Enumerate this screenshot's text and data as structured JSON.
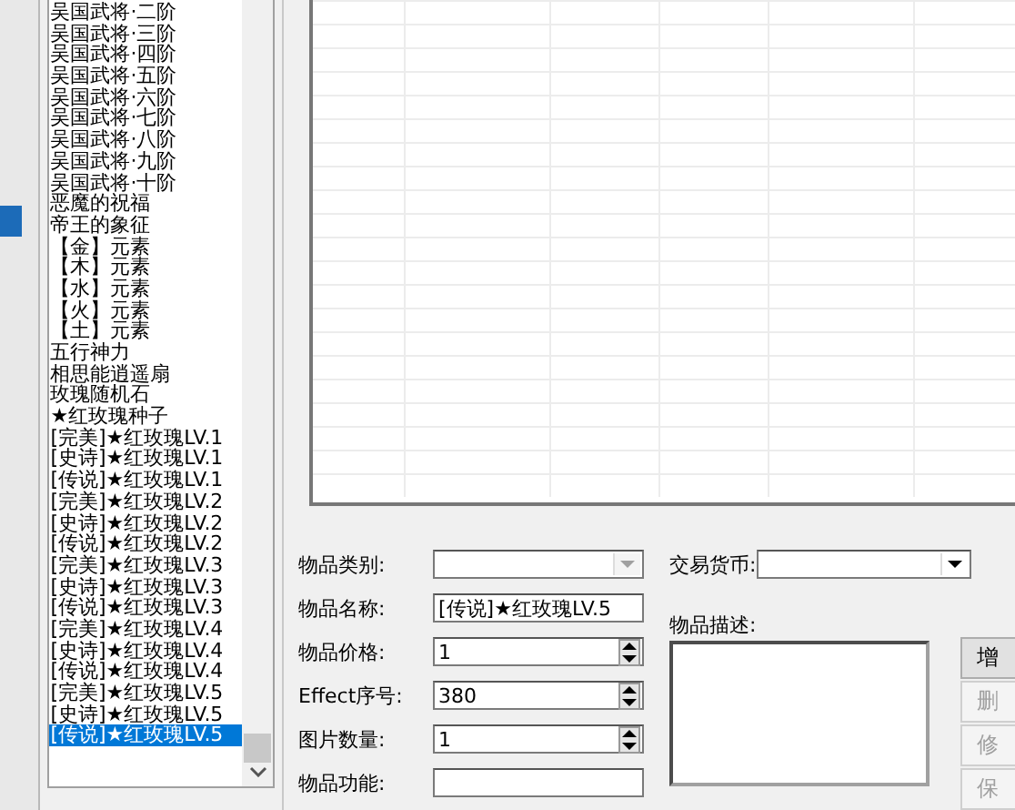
{
  "item_list": {
    "items": [
      {
        "label": "吴国武将·二阶",
        "selected": false
      },
      {
        "label": "吴国武将·三阶",
        "selected": false
      },
      {
        "label": "吴国武将·四阶",
        "selected": false
      },
      {
        "label": "吴国武将·五阶",
        "selected": false
      },
      {
        "label": "吴国武将·六阶",
        "selected": false
      },
      {
        "label": "吴国武将·七阶",
        "selected": false
      },
      {
        "label": "吴国武将·八阶",
        "selected": false
      },
      {
        "label": "吴国武将·九阶",
        "selected": false
      },
      {
        "label": "吴国武将·十阶",
        "selected": false
      },
      {
        "label": "恶魔的祝福",
        "selected": false
      },
      {
        "label": "帝王的象征",
        "selected": false
      },
      {
        "label": "【金】元素",
        "selected": false
      },
      {
        "label": "【木】元素",
        "selected": false
      },
      {
        "label": "【水】元素",
        "selected": false
      },
      {
        "label": "【火】元素",
        "selected": false
      },
      {
        "label": "【土】元素",
        "selected": false
      },
      {
        "label": "五行神力",
        "selected": false
      },
      {
        "label": "相思能逍遥扇",
        "selected": false
      },
      {
        "label": "玫瑰随机石",
        "selected": false
      },
      {
        "label": "★红玫瑰种子",
        "selected": false
      },
      {
        "label": "[完美]★红玫瑰LV.1",
        "selected": false
      },
      {
        "label": "[史诗]★红玫瑰LV.1",
        "selected": false
      },
      {
        "label": "[传说]★红玫瑰LV.1",
        "selected": false
      },
      {
        "label": "[完美]★红玫瑰LV.2",
        "selected": false
      },
      {
        "label": "[史诗]★红玫瑰LV.2",
        "selected": false
      },
      {
        "label": "[传说]★红玫瑰LV.2",
        "selected": false
      },
      {
        "label": "[完美]★红玫瑰LV.3",
        "selected": false
      },
      {
        "label": "[史诗]★红玫瑰LV.3",
        "selected": false
      },
      {
        "label": "[传说]★红玫瑰LV.3",
        "selected": false
      },
      {
        "label": "[完美]★红玫瑰LV.4",
        "selected": false
      },
      {
        "label": "[史诗]★红玫瑰LV.4",
        "selected": false
      },
      {
        "label": "[传说]★红玫瑰LV.4",
        "selected": false
      },
      {
        "label": "[完美]★红玫瑰LV.5",
        "selected": false
      },
      {
        "label": "[史诗]★红玫瑰LV.5",
        "selected": false
      },
      {
        "label": "[传说]★红玫瑰LV.5",
        "selected": true
      }
    ]
  },
  "form": {
    "fields": [
      {
        "label": "物品类别:",
        "kind": "combo",
        "disabled": true
      },
      {
        "label": "物品名称:",
        "kind": "text",
        "value": "[传说]★红玫瑰LV.5"
      },
      {
        "label": "物品价格:",
        "kind": "spin",
        "value": "1"
      },
      {
        "label": "Effect序号:",
        "kind": "spin",
        "value": "380"
      },
      {
        "label": "图片数量:",
        "kind": "spin",
        "value": "1"
      },
      {
        "label": "物品功能:",
        "kind": "text"
      }
    ]
  },
  "currency": {
    "label": "交易货币:",
    "kind": "combo",
    "disabled": false
  },
  "description": {
    "label": "物品描述:"
  },
  "buttons": [
    {
      "label": "增",
      "disabled": false
    },
    {
      "label": "删",
      "disabled": true
    },
    {
      "label": "修",
      "disabled": true
    },
    {
      "label": "保",
      "disabled": true
    }
  ]
}
